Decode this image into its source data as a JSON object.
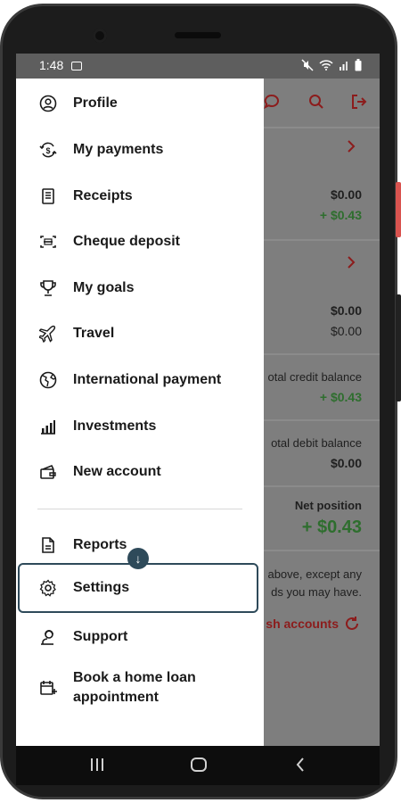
{
  "status": {
    "time": "1:48"
  },
  "background": {
    "rows": [
      {
        "primary": "$0.00",
        "secondary": "+ $0.43"
      },
      {
        "primary": "$0.00",
        "secondary": "$0.00"
      }
    ],
    "total_credit": {
      "label": "otal credit balance",
      "value": "+ $0.43"
    },
    "total_debit": {
      "label": "otal debit balance",
      "value": "$0.00"
    },
    "net_position": {
      "label": "Net position",
      "value": "+ $0.43"
    },
    "disclaimer_line1": "above, except any",
    "disclaimer_line2": "ds you may have.",
    "refresh_label": "sh accounts"
  },
  "menu": {
    "items": [
      {
        "label": "Profile",
        "icon": "profile-icon"
      },
      {
        "label": "My payments",
        "icon": "payments-icon"
      },
      {
        "label": "Receipts",
        "icon": "receipts-icon"
      },
      {
        "label": "Cheque deposit",
        "icon": "cheque-icon"
      },
      {
        "label": "My goals",
        "icon": "trophy-icon"
      },
      {
        "label": "Travel",
        "icon": "plane-icon"
      },
      {
        "label": "International payment",
        "icon": "globe-icon"
      },
      {
        "label": "Investments",
        "icon": "chart-icon"
      },
      {
        "label": "New account",
        "icon": "wallet-icon"
      }
    ],
    "secondary": [
      {
        "label": "Reports",
        "icon": "reports-icon"
      },
      {
        "label": "Settings",
        "icon": "gear-icon"
      },
      {
        "label": "Support",
        "icon": "support-icon"
      },
      {
        "label": "Book a home loan appointment",
        "line1": "Book a home loan",
        "line2": "appointment",
        "icon": "calendar-add-icon"
      }
    ]
  },
  "colors": {
    "accent": "#c8102e",
    "highlight": "#2e4a5a",
    "positive": "#2e6e2e"
  }
}
